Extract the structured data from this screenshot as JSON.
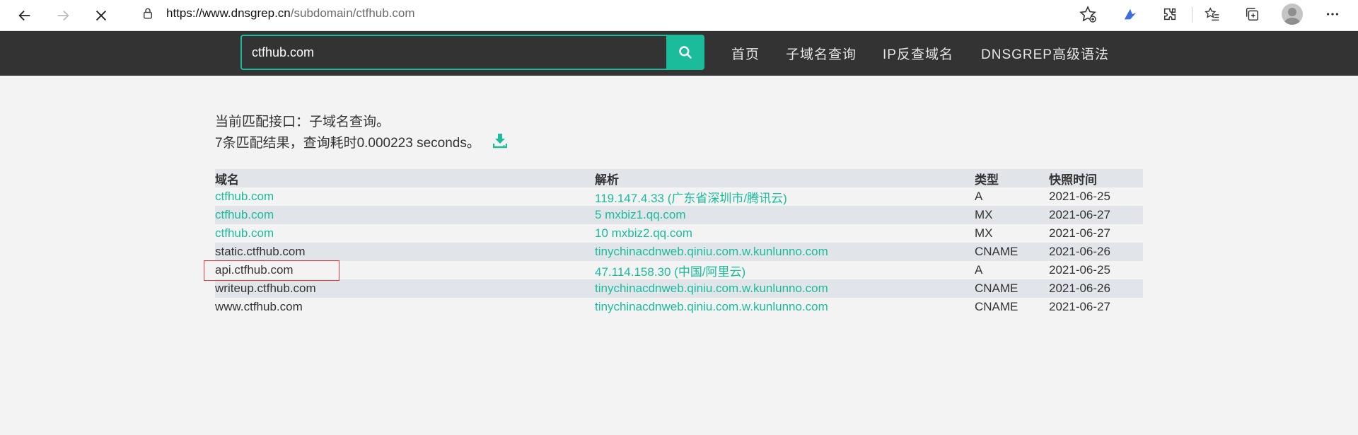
{
  "browser": {
    "url_host": "https://www.dnsgrep.cn",
    "url_path": "/subdomain/ctfhub.com"
  },
  "search": {
    "value": "ctfhub.com"
  },
  "nav": {
    "items": [
      "首页",
      "子域名查询",
      "IP反查域名",
      "DNSGREP高级语法"
    ]
  },
  "result_info": {
    "line1": "当前匹配接口：子域名查询。",
    "line2": "7条匹配结果，查询耗时0.000223 seconds。"
  },
  "table": {
    "headers": [
      "域名",
      "解析",
      "类型",
      "快照时间"
    ],
    "rows": [
      {
        "domain": "ctfhub.com",
        "domain_link": true,
        "record": "119.147.4.33 (广东省深圳市/腾讯云)",
        "type": "A",
        "time": "2021-06-25"
      },
      {
        "domain": "ctfhub.com",
        "domain_link": true,
        "record": "5 mxbiz1.qq.com",
        "type": "MX",
        "time": "2021-06-27"
      },
      {
        "domain": "ctfhub.com",
        "domain_link": true,
        "record": "10 mxbiz2.qq.com",
        "type": "MX",
        "time": "2021-06-27"
      },
      {
        "domain": "static.ctfhub.com",
        "domain_link": false,
        "record": "tinychinacdnweb.qiniu.com.w.kunlunno.com",
        "type": "CNAME",
        "time": "2021-06-26"
      },
      {
        "domain": "api.ctfhub.com",
        "domain_link": false,
        "record": "47.114.158.30 (中国/阿里云)",
        "type": "A",
        "time": "2021-06-25"
      },
      {
        "domain": "writeup.ctfhub.com",
        "domain_link": false,
        "record": "tinychinacdnweb.qiniu.com.w.kunlunno.com",
        "type": "CNAME",
        "time": "2021-06-26"
      },
      {
        "domain": "www.ctfhub.com",
        "domain_link": false,
        "record": "tinychinacdnweb.qiniu.com.w.kunlunno.com",
        "type": "CNAME",
        "time": "2021-06-27"
      }
    ]
  },
  "colors": {
    "accent": "#1abc9c",
    "header_bg": "#333333",
    "stripe": "#e1e4e9",
    "highlight": "#e03c3c"
  }
}
